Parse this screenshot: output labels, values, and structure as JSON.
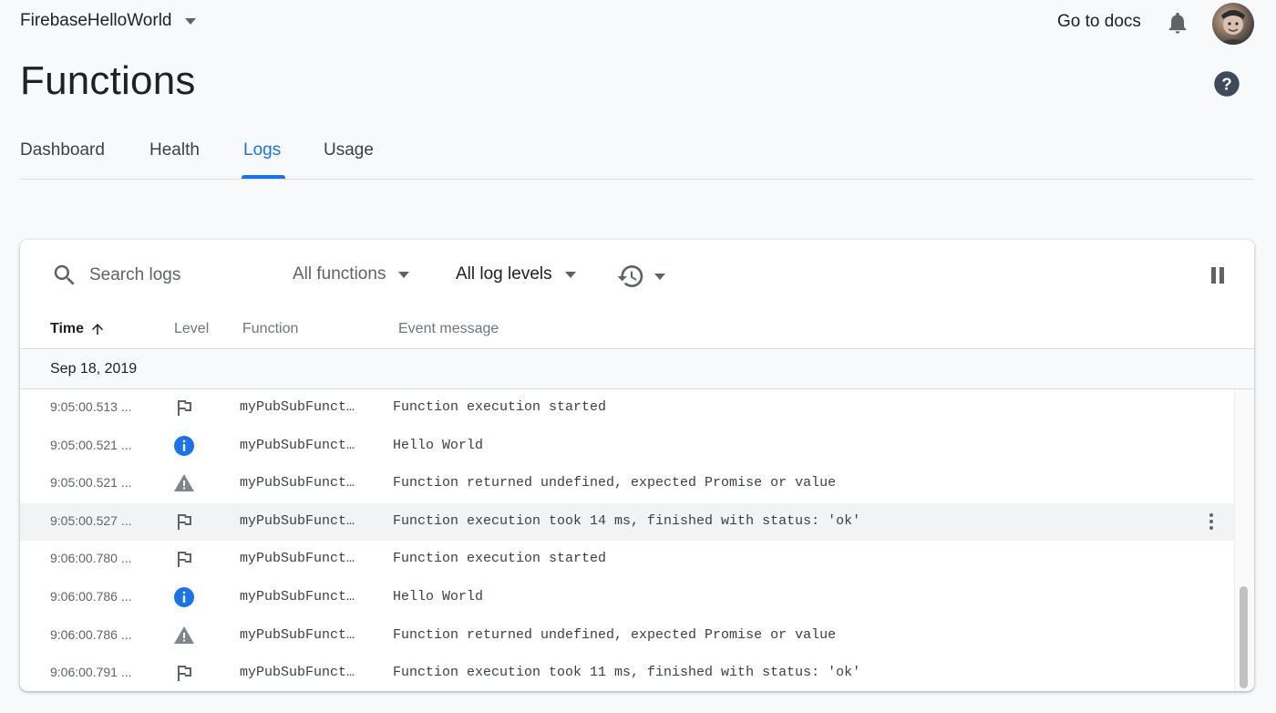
{
  "topbar": {
    "project_name": "FirebaseHelloWorld",
    "docs_label": "Go to docs"
  },
  "page": {
    "title": "Functions"
  },
  "tabs": [
    {
      "label": "Dashboard",
      "active": false
    },
    {
      "label": "Health",
      "active": false
    },
    {
      "label": "Logs",
      "active": true
    },
    {
      "label": "Usage",
      "active": false
    }
  ],
  "toolbar": {
    "search_placeholder": "Search logs",
    "functions_filter": "All functions",
    "levels_filter": "All log levels"
  },
  "table": {
    "headers": {
      "time": "Time",
      "level": "Level",
      "function": "Function",
      "message": "Event message"
    },
    "date_group": "Sep 18, 2019",
    "rows": [
      {
        "time": "9:05:00.513 ...",
        "level": "flag-icon",
        "function": "myPubSubFunct…",
        "message": "Function execution started"
      },
      {
        "time": "9:05:00.521 ...",
        "level": "info-icon",
        "function": "myPubSubFunct…",
        "message": "Hello World"
      },
      {
        "time": "9:05:00.521 ...",
        "level": "warning-icon",
        "function": "myPubSubFunct…",
        "message": "Function returned undefined, expected Promise or value"
      },
      {
        "time": "9:05:00.527 ...",
        "level": "flag-icon",
        "function": "myPubSubFunct…",
        "message": "Function execution took 14 ms, finished with status: 'ok'"
      },
      {
        "time": "9:06:00.780 ...",
        "level": "flag-icon",
        "function": "myPubSubFunct…",
        "message": "Function execution started"
      },
      {
        "time": "9:06:00.786 ...",
        "level": "info-icon",
        "function": "myPubSubFunct…",
        "message": "Hello World"
      },
      {
        "time": "9:06:00.786 ...",
        "level": "warning-icon",
        "function": "myPubSubFunct…",
        "message": "Function returned undefined, expected Promise or value"
      },
      {
        "time": "9:06:00.791 ...",
        "level": "flag-icon",
        "function": "myPubSubFunct…",
        "message": "Function execution took 11 ms, finished with status: 'ok'"
      }
    ]
  },
  "colors": {
    "accent": "#1a73e8",
    "info": "#1a73e8",
    "warning": "#9aa0a6",
    "text": "#202124"
  }
}
